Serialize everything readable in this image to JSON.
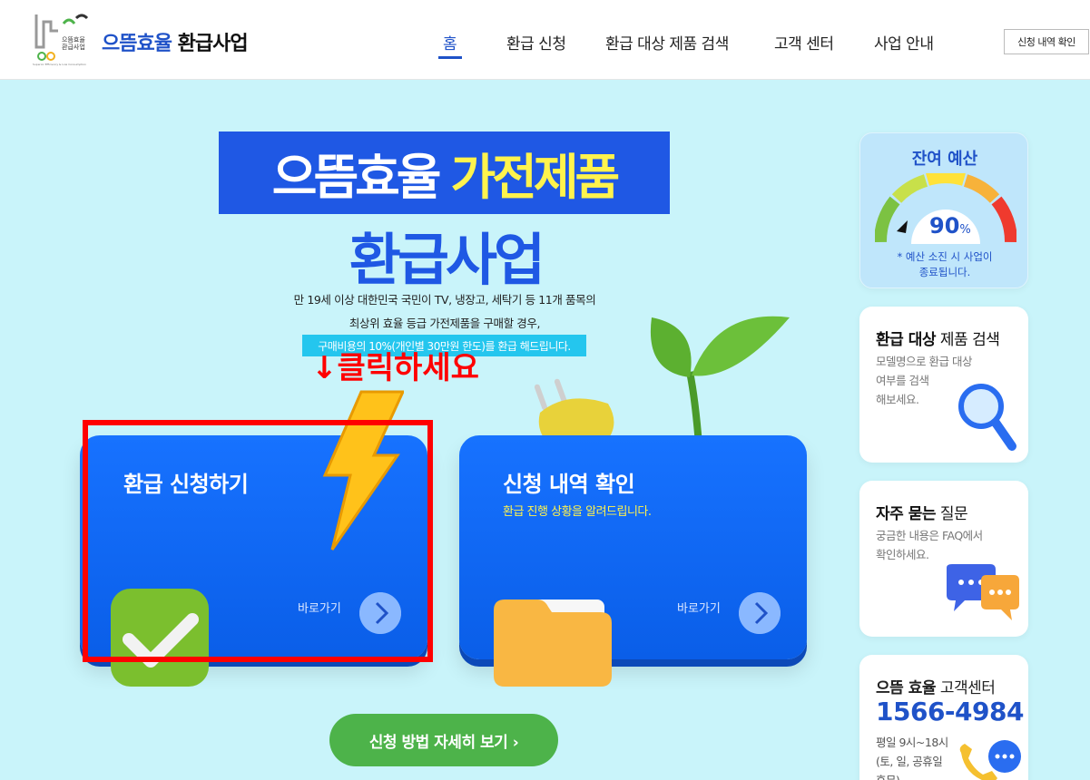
{
  "header": {
    "logo_text_line1": "으뜸효율",
    "logo_text_line2": "환급사업",
    "logo_subtext": "Superior Efficiency & Low Consumption",
    "title_blue": "으뜸효율",
    "title_dark": "환급사업",
    "nav": [
      "홈",
      "환급 신청",
      "환급 대상 제품 검색",
      "고객 센터",
      "사업 안내"
    ],
    "history_button": "신청 내역 확인"
  },
  "hero": {
    "banner_white": "으뜸효율",
    "banner_yellow": "가전제품",
    "subtitle": "환급사업",
    "desc_line1": "만 19세 이상 대한민국 국민이 TV, 냉장고, 세탁기 등 11개 품목의",
    "desc_line2": "최상위 효율 등급 가전제품을 구매할 경우,",
    "highlight": "구매비용의 10%(개인별 30만원 한도)를 환급 해드립니다.",
    "click_note": "↓클릭하세요"
  },
  "cards": {
    "apply_title": "환급 신청하기",
    "apply_go": "바로가기",
    "history_title": "신청 내역 확인",
    "history_desc": "환급 진행 상황을 알려드립니다.",
    "history_go": "바로가기"
  },
  "guide_button": "신청 방법 자세히 보기  ›",
  "budget": {
    "title": "잔여 예산",
    "percent": "90",
    "percent_unit": "%",
    "gauge_level": 0.9,
    "note": "* 예산 소진 시 사업이\n종료됩니다."
  },
  "search_panel": {
    "title_bold": "환급 대상",
    "title_rest": "제품 검색",
    "desc_line1": "모델명으로 환급 대상",
    "desc_line2": "여부를 검색",
    "desc_line3": "해보세요."
  },
  "faq_panel": {
    "title_bold": "자주 묻는",
    "title_rest": "질문",
    "desc_line1": "궁금한 내용은 FAQ에서",
    "desc_line2": "확인하세요."
  },
  "cs_panel": {
    "title_bold": "으뜸 효율",
    "title_rest": "고객센터",
    "phone": "1566-4984",
    "hours_line1": "평일 9시~18시",
    "hours_line2": "(토, 일, 공휴일",
    "hours_line3": "휴무)"
  },
  "colors": {
    "primary": "#1f52c8",
    "card_blue": "#0a66ff",
    "background": "#c9f4fa",
    "highlight": "#24c6ee",
    "yellow": "#fff34d",
    "green_button": "#4db34a",
    "annotation_red": "#ff0000"
  }
}
